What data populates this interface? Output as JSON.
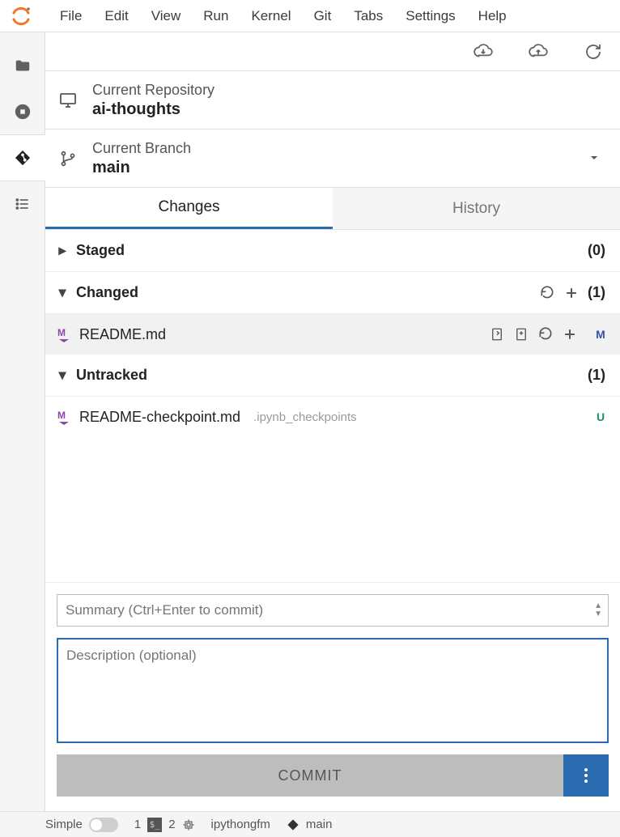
{
  "menubar": [
    "File",
    "Edit",
    "View",
    "Run",
    "Kernel",
    "Git",
    "Tabs",
    "Settings",
    "Help"
  ],
  "repo": {
    "label": "Current Repository",
    "value": "ai-thoughts"
  },
  "branch": {
    "label": "Current Branch",
    "value": "main"
  },
  "tabs": {
    "changes": "Changes",
    "history": "History"
  },
  "groups": {
    "staged": {
      "label": "Staged",
      "count": "(0)"
    },
    "changed": {
      "label": "Changed",
      "count": "(1)"
    },
    "untracked": {
      "label": "Untracked",
      "count": "(1)"
    }
  },
  "files": {
    "changed": [
      {
        "icon": "M",
        "name": "README.md",
        "folder": "",
        "status": "M"
      }
    ],
    "untracked": [
      {
        "icon": "M",
        "name": "README-checkpoint.md",
        "folder": ".ipynb_checkpoints",
        "status": "U"
      }
    ]
  },
  "commit": {
    "summary_placeholder": "Summary (Ctrl+Enter to commit)",
    "description_placeholder": "Description (optional)",
    "button": "COMMIT"
  },
  "statusbar": {
    "simple": "Simple",
    "one": "1",
    "two": "2",
    "lang": "ipythongfm",
    "branch": "main"
  }
}
